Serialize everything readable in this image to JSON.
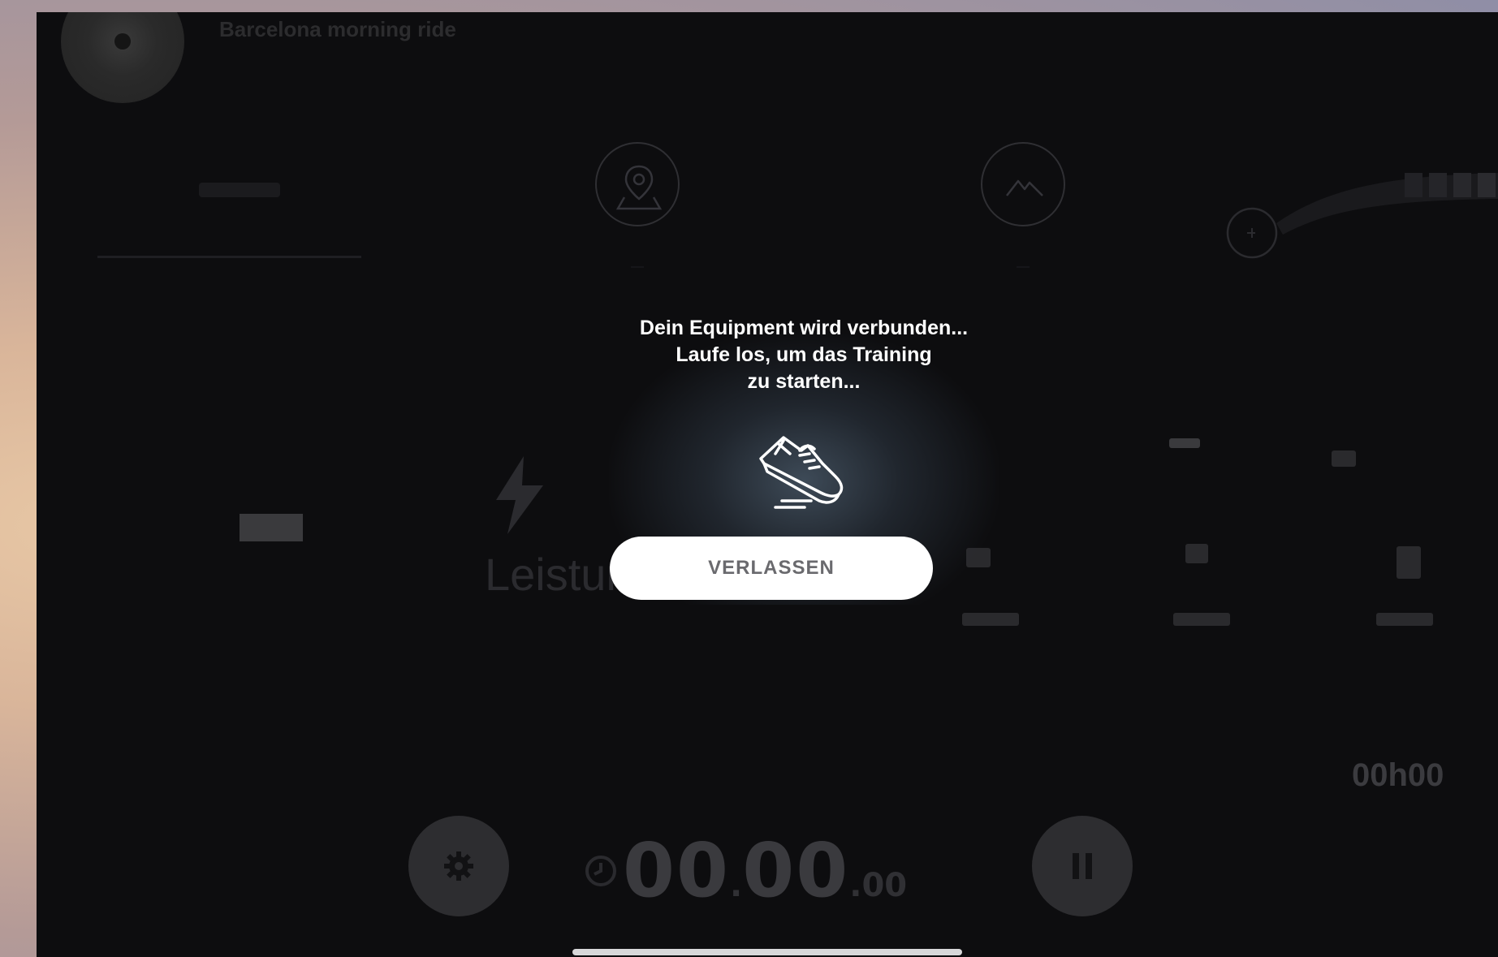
{
  "workout": {
    "title": "Barcelona morning ride"
  },
  "dialog": {
    "line1": "Dein Equipment wird verbunden...",
    "line2": "Laufe los, um das Training",
    "line3": "zu starten...",
    "exit_label": "VERLASSEN",
    "icon": "running-shoe-icon"
  },
  "metrics": {
    "main_label": "Leistung",
    "elapsed_right": "00h00"
  },
  "timer": {
    "minutes": "00",
    "seconds": "00",
    "hundredths": "00",
    "sep1": ".",
    "sep2": "."
  },
  "colors": {
    "background": "#0d0d0f",
    "button": "#ffffff",
    "button_text": "#6a6a6e"
  }
}
